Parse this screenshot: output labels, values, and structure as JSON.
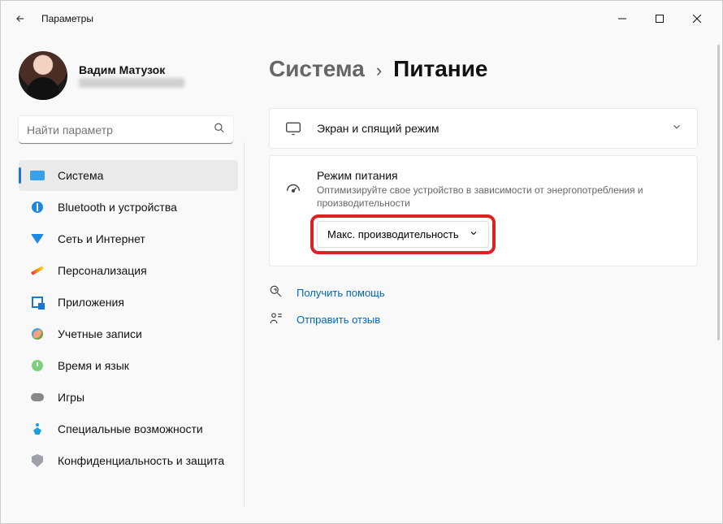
{
  "titlebar": {
    "title": "Параметры"
  },
  "user": {
    "name": "Вадим Матузок"
  },
  "search": {
    "placeholder": "Найти параметр"
  },
  "sidebar": {
    "items": [
      {
        "label": "Система"
      },
      {
        "label": "Bluetooth и устройства"
      },
      {
        "label": "Сеть и Интернет"
      },
      {
        "label": "Персонализация"
      },
      {
        "label": "Приложения"
      },
      {
        "label": "Учетные записи"
      },
      {
        "label": "Время и язык"
      },
      {
        "label": "Игры"
      },
      {
        "label": "Специальные возможности"
      },
      {
        "label": "Конфиденциальность и защита"
      }
    ]
  },
  "breadcrumb": {
    "parent": "Система",
    "sep": "›",
    "current": "Питание"
  },
  "screen_card": {
    "title": "Экран и спящий режим"
  },
  "power_mode": {
    "title": "Режим питания",
    "subtitle": "Оптимизируйте свое устройство в зависимости от энергопотребления и производительности",
    "selected": "Макс. производительность"
  },
  "links": {
    "help": "Получить помощь",
    "feedback": "Отправить отзыв"
  }
}
